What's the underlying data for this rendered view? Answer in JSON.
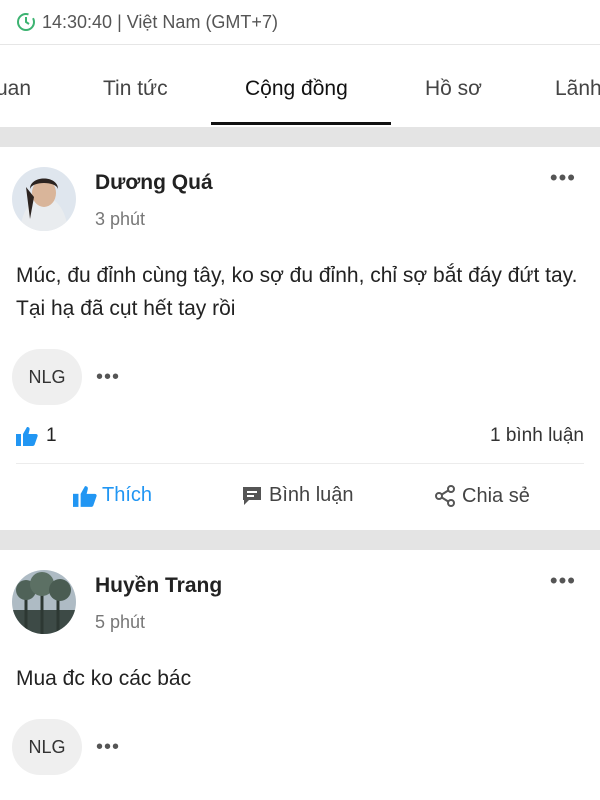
{
  "status_bar": {
    "clock_text": "14:30:40 | Việt Nam (GMT+7)"
  },
  "tabs": [
    {
      "label": "uan"
    },
    {
      "label": "Tin tức"
    },
    {
      "label": "Cộng đồng"
    },
    {
      "label": "Hồ sơ"
    },
    {
      "label": "Lãnh"
    }
  ],
  "active_tab": "Cộng đồng",
  "posts": [
    {
      "author": "Dương Quá",
      "time": "3 phút",
      "content": "Múc, đu đỉnh cùng tây, ko sợ đu đỉnh, chỉ sợ bắt đáy đứt tay. Tại hạ đã cụt hết tay rồi",
      "tag": "NLG",
      "like_count": "1",
      "comment_count_text": "1 bình luận",
      "actions": {
        "like": "Thích",
        "comment": "Bình luận",
        "share": "Chia sẻ"
      }
    },
    {
      "author": "Huyền Trang",
      "time": "5 phút",
      "content": "Mua đc ko các bác",
      "tag": "NLG"
    }
  ],
  "icons": {
    "clock": "clock-icon",
    "more": "more-horizontal-icon",
    "like": "thumbs-up-icon",
    "comment": "comment-icon",
    "share": "share-icon"
  },
  "colors": {
    "accent": "#2196f3",
    "status_icon": "#3cb371",
    "divider": "#e4e4e4"
  }
}
